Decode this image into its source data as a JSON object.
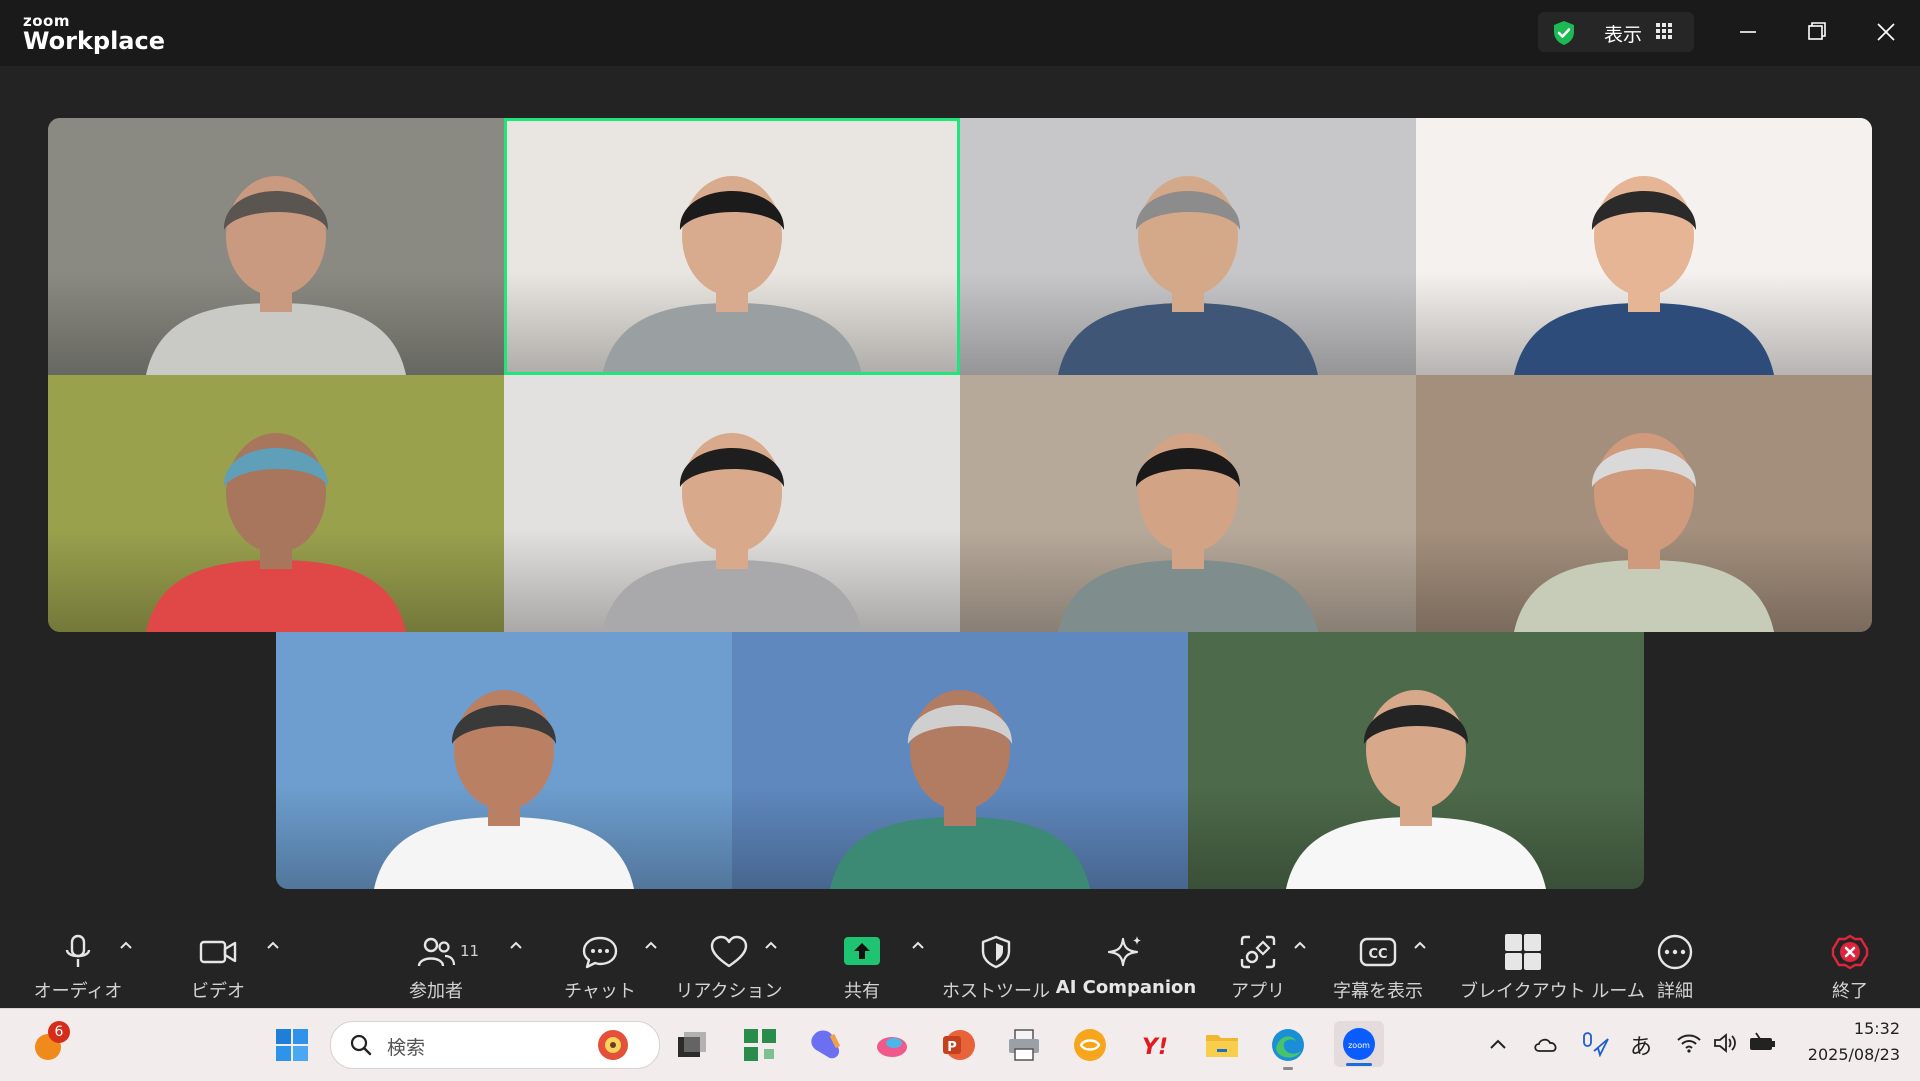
{
  "titlebar": {
    "brand_small": "zoom",
    "brand_big": "Workplace",
    "view_label": "表示"
  },
  "participants": [
    {
      "tile": 1,
      "bg": "#8a8a82",
      "shirt": "#c9c9c6",
      "skin": "#c99a7f",
      "hair": "#5a5550"
    },
    {
      "tile": 2,
      "bg": "#e9e6e1",
      "shirt": "#9aa0a2",
      "skin": "#d8ab8e",
      "hair": "#1b1b1b",
      "active": true
    },
    {
      "tile": 3,
      "bg": "#c7c7c9",
      "shirt": "#3f5676",
      "skin": "#d4a989",
      "hair": "#8c8c8c"
    },
    {
      "tile": 4,
      "bg": "#f4f1ee",
      "shirt": "#2d4c7a",
      "skin": "#e5b595",
      "hair": "#2a2a2a"
    },
    {
      "tile": 5,
      "bg": "#9aa14d",
      "shirt": "#e04848",
      "skin": "#a8765c",
      "hair": "#5fa0b8"
    },
    {
      "tile": 6,
      "bg": "#e3e1df",
      "shirt": "#a9a8ab",
      "skin": "#d8a98b",
      "hair": "#1e1e1e"
    },
    {
      "tile": 7,
      "bg": "#b7a99a",
      "shirt": "#7f8e8d",
      "skin": "#d2a384",
      "hair": "#1a1a1a"
    },
    {
      "tile": 8,
      "bg": "#a48f7c",
      "shirt": "#c6ccb8",
      "skin": "#cf9b7c",
      "hair": "#d9d9d9"
    },
    {
      "tile": 9,
      "bg": "#6d9ecf",
      "shirt": "#f5f5f5",
      "skin": "#b98064",
      "hair": "#3a3a3a"
    },
    {
      "tile": 10,
      "bg": "#5f88be",
      "shirt": "#3d8a74",
      "skin": "#b17c62",
      "hair": "#cfcfcf"
    },
    {
      "tile": 11,
      "bg": "#4d6a4a",
      "shirt": "#f7f7f7",
      "skin": "#d8a88a",
      "hair": "#242424"
    }
  ],
  "toolbar": {
    "audio": "オーディオ",
    "video": "ビデオ",
    "participants": "参加者",
    "participants_count": "11",
    "chat": "チャット",
    "reactions": "リアクション",
    "share": "共有",
    "host_tools": "ホストツール",
    "ai_companion": "AI Companion",
    "apps": "アプリ",
    "captions": "字幕を表示",
    "breakout": "ブレイクアウト ルーム",
    "more": "詳細",
    "end": "終了"
  },
  "colors": {
    "accent_green": "#1ee67a",
    "share_green": "#1ec472",
    "end_red": "#e0243c",
    "shield_green": "#1db954"
  },
  "taskbar": {
    "search_placeholder": "検索",
    "notification_count": "6",
    "ime_label": "あ",
    "time": "15:32",
    "date": "2025/08/23"
  }
}
